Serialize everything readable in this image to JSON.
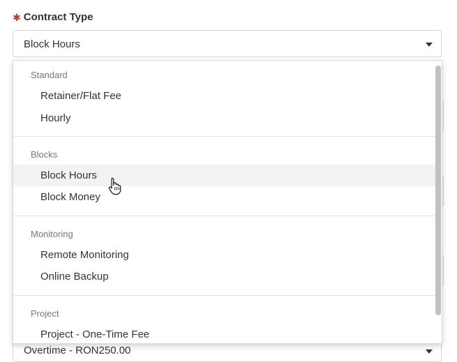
{
  "field": {
    "required_mark": "✱",
    "label": "Contract Type",
    "selected_value": "Block Hours"
  },
  "dropdown": {
    "groups": [
      {
        "label": "Standard",
        "options": [
          "Retainer/Flat Fee",
          "Hourly"
        ]
      },
      {
        "label": "Blocks",
        "options": [
          "Block Hours",
          "Block Money"
        ]
      },
      {
        "label": "Monitoring",
        "options": [
          "Remote Monitoring",
          "Online Backup"
        ]
      },
      {
        "label": "Project",
        "options": [
          "Project - One-Time Fee"
        ]
      }
    ],
    "hovered_option": "Block Hours"
  },
  "below_field": {
    "value": "Overtime - RON250.00"
  },
  "colors": {
    "required": "#c0392b",
    "hover_bg": "#f2f2f2",
    "border": "#d6d6d6"
  }
}
